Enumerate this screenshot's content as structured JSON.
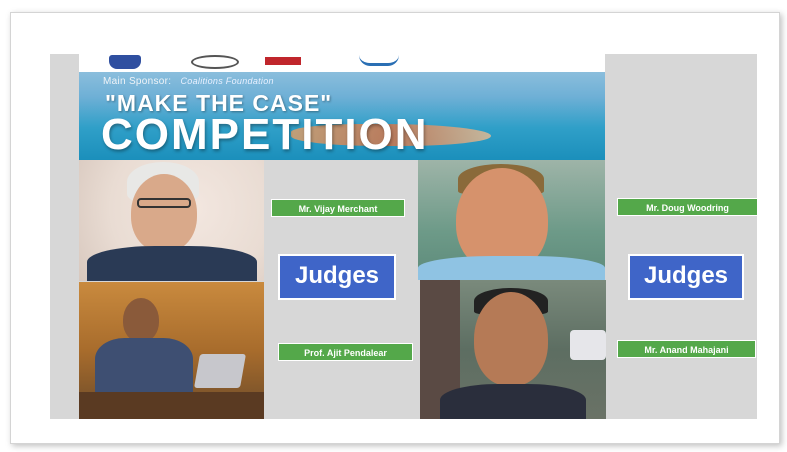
{
  "banner": {
    "sponsor_label": "Main Sponsor:",
    "sponsor_name": "Coalitions Foundation",
    "headline": "\"MAKE THE CASE\"",
    "title": "COMPETITION"
  },
  "judges_label_left": "Judges",
  "judges_label_right": "Judges",
  "judges": [
    {
      "name": "Mr. Vijay Merchant"
    },
    {
      "name": "Prof. Ajit Pendalear"
    },
    {
      "name": "Mr. Doug Woodring"
    },
    {
      "name": "Mr. Anand Mahajani"
    }
  ],
  "colors": {
    "tag_green": "#54a84a",
    "judges_blue": "#3f65c8",
    "banner_blue": "#2f9fc8",
    "slide_gray": "#d7d7d7"
  }
}
